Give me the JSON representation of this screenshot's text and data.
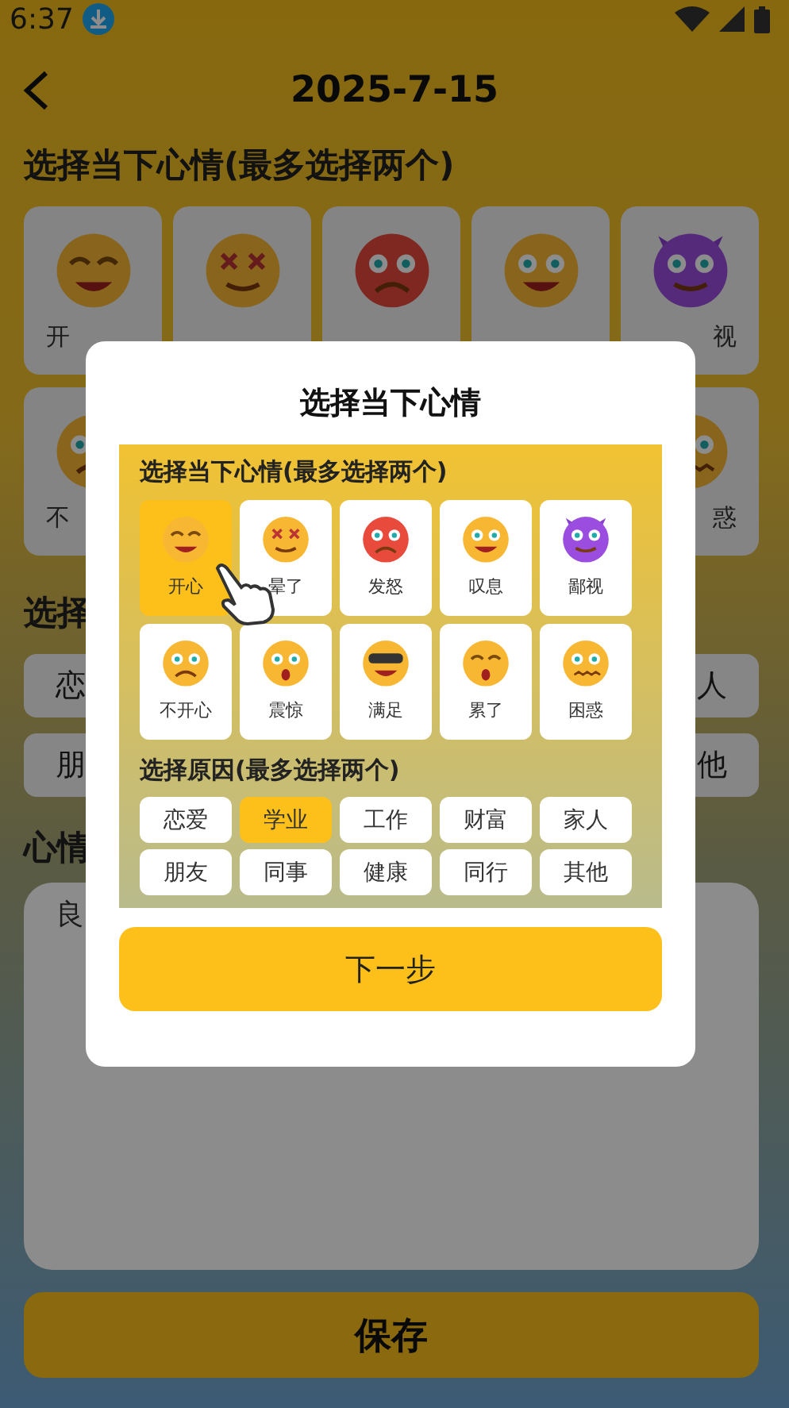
{
  "status_bar": {
    "time": "6:37"
  },
  "header": {
    "title": "2025-7-15"
  },
  "page": {
    "mood_heading": "选择当下心情(最多选择两个)",
    "mood_labels_left": [
      "开",
      "不"
    ],
    "mood_labels_right": [
      "视",
      "惑"
    ],
    "reason_heading": "选择",
    "reason_labels_left": [
      "恋",
      "朋"
    ],
    "reason_labels_right": [
      "人",
      "他"
    ],
    "note_heading": "心情",
    "note_value": "良",
    "save_button": "保存"
  },
  "dialog": {
    "title": "选择当下心情",
    "mood_heading": "选择当下心情(最多选择两个)",
    "moods": [
      {
        "label": "开心",
        "selected": true
      },
      {
        "label": "晕了",
        "selected": false
      },
      {
        "label": "发怒",
        "selected": false
      },
      {
        "label": "叹息",
        "selected": false
      },
      {
        "label": "鄙视",
        "selected": false
      },
      {
        "label": "不开心",
        "selected": false
      },
      {
        "label": "震惊",
        "selected": false
      },
      {
        "label": "满足",
        "selected": false
      },
      {
        "label": "累了",
        "selected": false
      },
      {
        "label": "困惑",
        "selected": false
      }
    ],
    "reason_heading": "选择原因(最多选择两个)",
    "reasons": [
      {
        "label": "恋爱",
        "selected": false
      },
      {
        "label": "学业",
        "selected": true
      },
      {
        "label": "工作",
        "selected": false
      },
      {
        "label": "财富",
        "selected": false
      },
      {
        "label": "家人",
        "selected": false
      },
      {
        "label": "朋友",
        "selected": false
      },
      {
        "label": "同事",
        "selected": false
      },
      {
        "label": "健康",
        "selected": false
      },
      {
        "label": "同行",
        "selected": false
      },
      {
        "label": "其他",
        "selected": false
      }
    ],
    "next_button": "下一步"
  }
}
